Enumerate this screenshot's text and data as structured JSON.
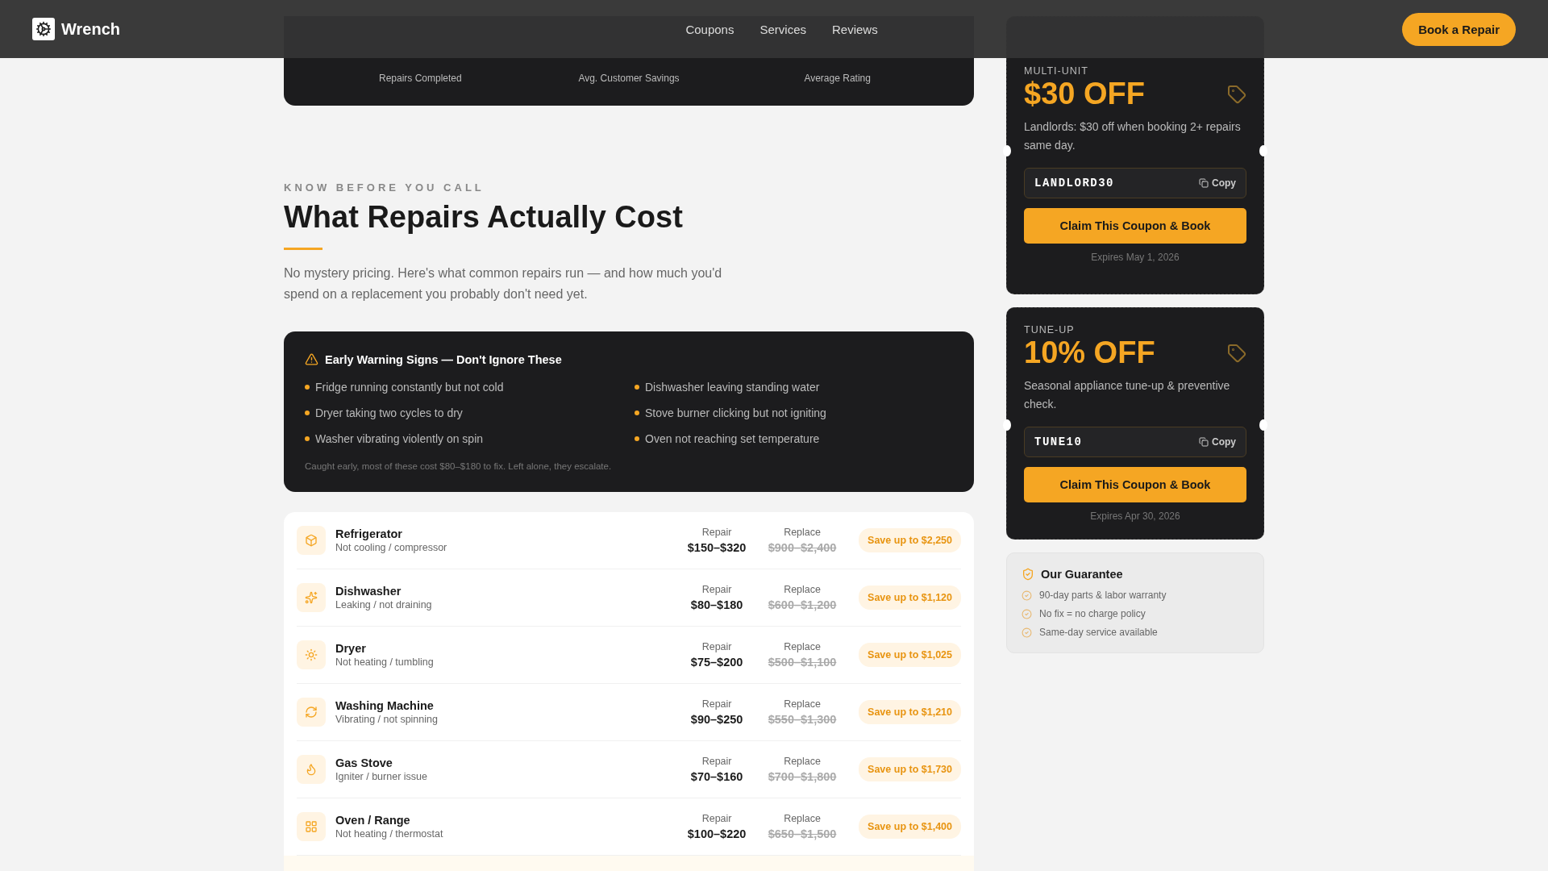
{
  "header": {
    "brand": "Wrench",
    "nav": [
      "Coupons",
      "Services",
      "Reviews"
    ],
    "cta": "Book a Repair"
  },
  "stats": [
    {
      "label": "Repairs Completed"
    },
    {
      "label": "Avg. Customer Savings"
    },
    {
      "label": "Average Rating"
    }
  ],
  "section": {
    "eyebrow": "KNOW BEFORE YOU CALL",
    "title": "What Repairs Actually Cost",
    "intro": "No mystery pricing. Here's what common repairs run — and how much you'd spend on a replacement you probably don't need yet."
  },
  "warning": {
    "title": "Early Warning Signs — Don't Ignore These",
    "signs": [
      "Fridge running constantly but not cold",
      "Dishwasher leaving standing water",
      "Dryer taking two cycles to dry",
      "Stove burner clicking but not igniting",
      "Washer vibrating violently on spin",
      "Oven not reaching set temperature"
    ],
    "note": "Caught early, most of these cost $80–$180 to fix. Left alone, they escalate."
  },
  "appliances": [
    {
      "kind": "fridge",
      "name": "Refrigerator",
      "issue": "Not cooling / compressor",
      "repair_label": "Repair",
      "repair": "$150–$320",
      "replace_label": "Replace",
      "replace": "$900–$2,400",
      "savings": "Save up to $2,250"
    },
    {
      "kind": "dishwasher",
      "name": "Dishwasher",
      "issue": "Leaking / not draining",
      "repair_label": "Repair",
      "repair": "$80–$180",
      "replace_label": "Replace",
      "replace": "$600–$1,200",
      "savings": "Save up to $1,120"
    },
    {
      "kind": "dryer",
      "name": "Dryer",
      "issue": "Not heating / tumbling",
      "repair_label": "Repair",
      "repair": "$75–$200",
      "replace_label": "Replace",
      "replace": "$500–$1,100",
      "savings": "Save up to $1,025"
    },
    {
      "kind": "washer",
      "name": "Washing Machine",
      "issue": "Vibrating / not spinning",
      "repair_label": "Repair",
      "repair": "$90–$250",
      "replace_label": "Replace",
      "replace": "$550–$1,300",
      "savings": "Save up to $1,210"
    },
    {
      "kind": "stove",
      "name": "Gas Stove",
      "issue": "Igniter / burner issue",
      "repair_label": "Repair",
      "repair": "$70–$160",
      "replace_label": "Replace",
      "replace": "$700–$1,800",
      "savings": "Save up to $1,730"
    },
    {
      "kind": "oven",
      "name": "Oven / Range",
      "issue": "Not heating / thermostat",
      "repair_label": "Repair",
      "repair": "$100–$220",
      "replace_label": "Replace",
      "replace": "$650–$1,500",
      "savings": "Save up to $1,400"
    }
  ],
  "coupons": [
    {
      "tag": "MULTI-UNIT",
      "amount": "$30 OFF",
      "description": "Landlords: $30 off when booking 2+ repairs same day.",
      "code": "LANDLORD30",
      "copy": "Copy",
      "claim": "Claim This Coupon & Book",
      "expires": "Expires May 1, 2026"
    },
    {
      "tag": "TUNE-UP",
      "amount": "10% OFF",
      "description": "Seasonal appliance tune-up & preventive check.",
      "code": "TUNE10",
      "copy": "Copy",
      "claim": "Claim This Coupon & Book",
      "expires": "Expires Apr 30, 2026"
    }
  ],
  "guarantee": {
    "title": "Our Guarantee",
    "items": [
      "90-day parts & labor warranty",
      "No fix = no charge policy",
      "Same-day service available"
    ]
  }
}
